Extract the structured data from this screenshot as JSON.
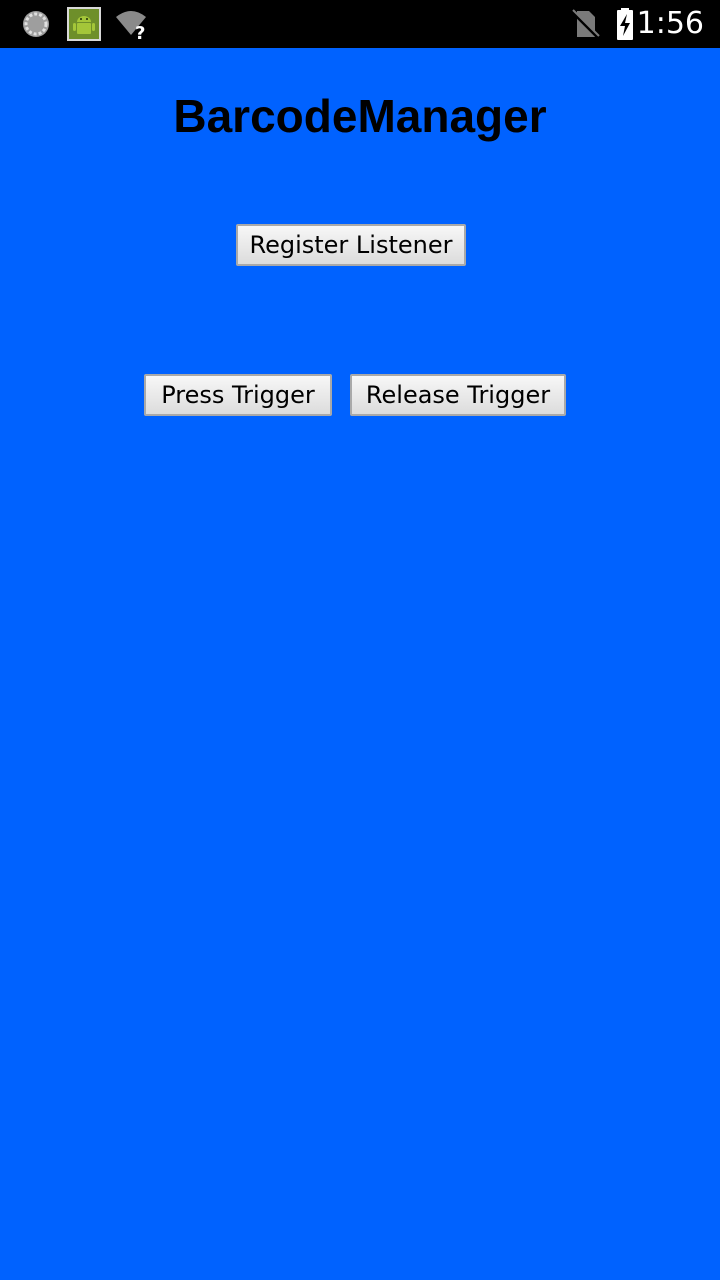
{
  "status_bar": {
    "time": "1:56",
    "icons": [
      "sync-icon",
      "android-debug-icon",
      "wifi-unknown-icon",
      "no-sim-icon",
      "battery-charging-icon"
    ]
  },
  "app": {
    "title": "BarcodeManager",
    "register_button": "Register Listener",
    "press_button": "Press Trigger",
    "release_button": "Release Trigger"
  },
  "colors": {
    "background": "#0062ff",
    "status_bar": "#000000"
  }
}
